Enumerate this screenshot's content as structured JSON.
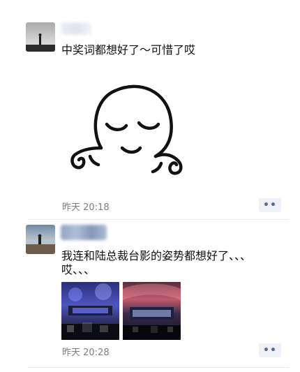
{
  "moments": [
    {
      "text": "中奖词都想好了～可惜了哎",
      "time": "昨天 20:18",
      "more_icon": "more-dots-icon",
      "more_label": "••"
    },
    {
      "text_line1": "我连和陆总裁台影的姿势都想好了、、、",
      "text_line2": "哎、、、",
      "time": "昨天 20:28",
      "more_icon": "more-dots-icon",
      "more_label": "••",
      "photos": [
        "concert-stage-photo",
        "concert-stage-photo"
      ]
    }
  ],
  "colors": {
    "link_blue": "#576b95",
    "time_gray": "#7f7f7f",
    "more_bg": "#eef1f6"
  }
}
